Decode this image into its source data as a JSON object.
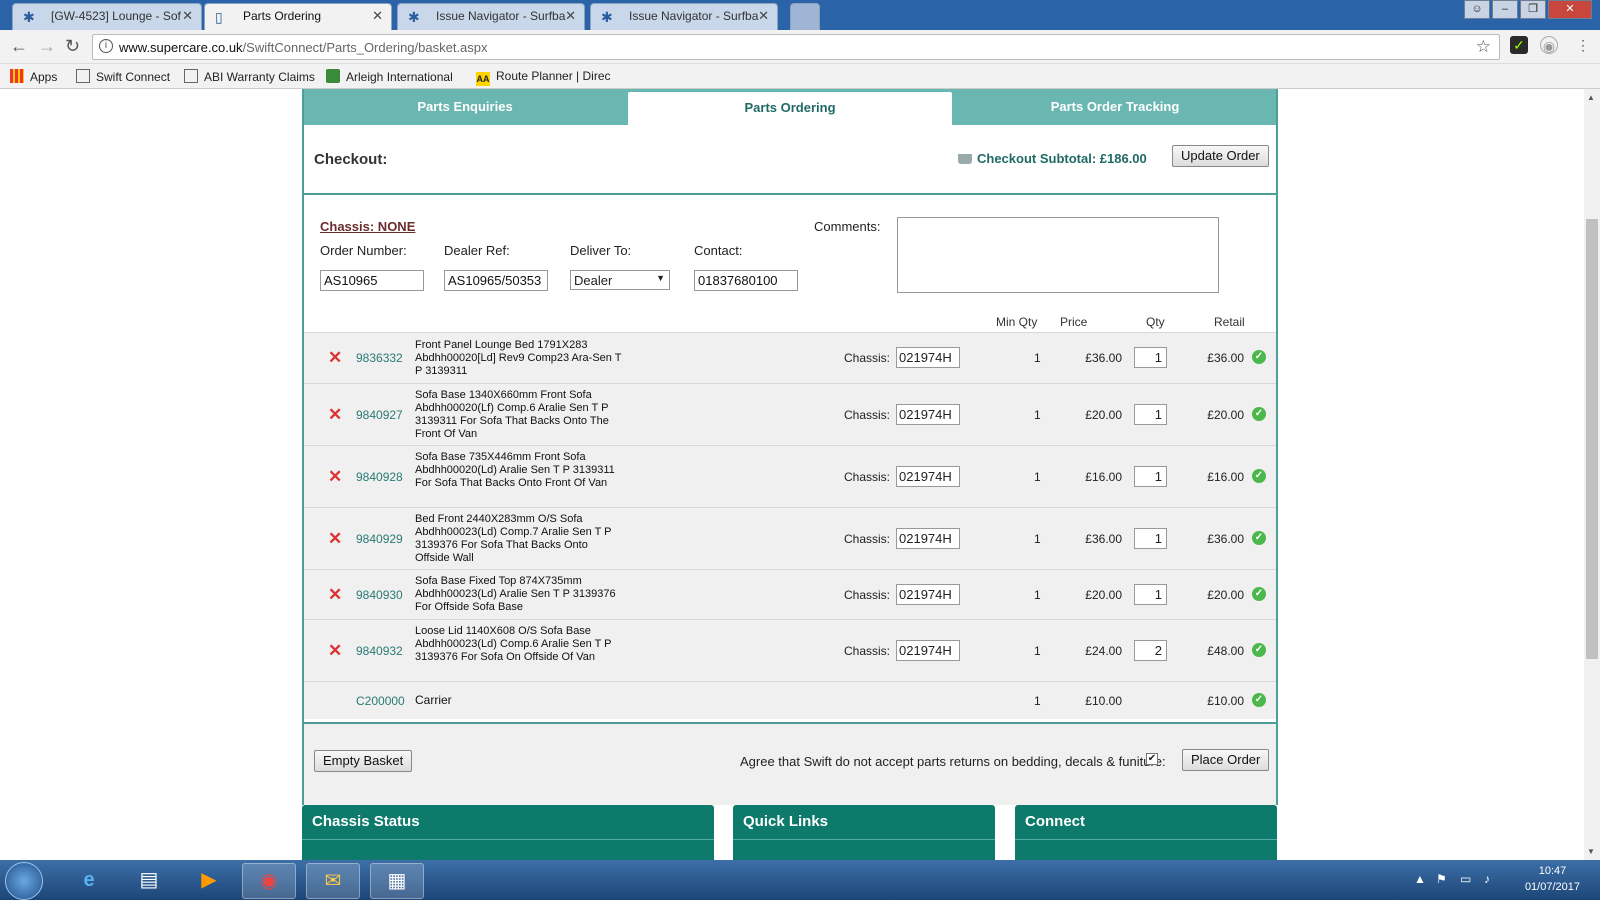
{
  "browser": {
    "tabs": [
      {
        "title": "[GW-4523] Lounge - Sof",
        "icon": "bug-icon"
      },
      {
        "title": "Parts Ordering",
        "icon": "page-icon"
      },
      {
        "title": "Issue Navigator - Surfba",
        "icon": "bug-icon"
      },
      {
        "title": "Issue Navigator - Surfba",
        "icon": "bug-icon"
      }
    ],
    "url_host": "www.supercare.co.uk",
    "url_path": "/SwiftConnect/Parts_Ordering/basket.aspx",
    "bookmarks": [
      {
        "label": "Apps",
        "icon": "apps-grid-icon"
      },
      {
        "label": "Swift Connect",
        "icon": "page-icon"
      },
      {
        "label": "ABI Warranty Claims",
        "icon": "page-icon"
      },
      {
        "label": "Arleigh International",
        "icon": "globe-icon"
      },
      {
        "label": "Route Planner | Direc",
        "icon": "aa-icon"
      }
    ]
  },
  "nav": {
    "tabs": [
      "Parts Enquiries",
      "Parts Ordering",
      "Parts Order Tracking"
    ],
    "active_tab": 1
  },
  "checkout": {
    "title": "Checkout:",
    "subtotal": "Checkout Subtotal: £186.00",
    "update_button": "Update Order"
  },
  "form": {
    "chassis_link": "Chassis: NONE",
    "order_number_label": "Order Number:",
    "order_number": "AS10965",
    "dealer_ref_label": "Dealer Ref:",
    "dealer_ref": "AS10965/50353",
    "deliver_to_label": "Deliver To:",
    "deliver_to": "Dealer",
    "contact_label": "Contact:",
    "contact": "01837680100",
    "comments_label": "Comments:",
    "comments": ""
  },
  "table": {
    "headers": {
      "min_qty": "Min Qty",
      "price": "Price",
      "qty": "Qty",
      "retail": "Retail"
    },
    "chassis_label": "Chassis:",
    "rows": [
      {
        "code": "9836332",
        "description": "Front Panel Lounge Bed 1791X283 Abdhh00020[Ld] Rev9 Comp23 Ara-Sen T P 3139311",
        "chassis": "021974H",
        "min_qty": "1",
        "price": "£36.00",
        "qty": "1",
        "retail": "£36.00"
      },
      {
        "code": "9840927",
        "description": "Sofa Base 1340X660mm Front Sofa Abdhh00020(Lf) Comp.6 Aralie Sen T P 3139311 For Sofa That Backs Onto The Front Of Van",
        "chassis": "021974H",
        "min_qty": "1",
        "price": "£20.00",
        "qty": "1",
        "retail": "£20.00"
      },
      {
        "code": "9840928",
        "description": "Sofa Base 735X446mm Front Sofa Abdhh00020(Ld) Aralie Sen T P 3139311 For Sofa That Backs Onto Front Of Van",
        "chassis": "021974H",
        "min_qty": "1",
        "price": "£16.00",
        "qty": "1",
        "retail": "£16.00"
      },
      {
        "code": "9840929",
        "description": "Bed Front 2440X283mm O/S Sofa Abdhh00023(Ld) Comp.7 Aralie Sen T P 3139376 For Sofa That Backs Onto Offside Wall",
        "chassis": "021974H",
        "min_qty": "1",
        "price": "£36.00",
        "qty": "1",
        "retail": "£36.00"
      },
      {
        "code": "9840930",
        "description": "Sofa Base Fixed Top 874X735mm Abdhh00023(Ld) Aralie Sen T P 3139376 For Offside Sofa Base",
        "chassis": "021974H",
        "min_qty": "1",
        "price": "£20.00",
        "qty": "1",
        "retail": "£20.00"
      },
      {
        "code": "9840932",
        "description": "Loose Lid 1140X608 O/S Sofa Base Abdhh00023(Ld) Comp.6 Aralie Sen T P 3139376 For Sofa On Offside Of Van",
        "chassis": "021974H",
        "min_qty": "1",
        "price": "£24.00",
        "qty": "2",
        "retail": "£48.00"
      }
    ],
    "carrier": {
      "code": "C200000",
      "description": "Carrier",
      "min_qty": "1",
      "price": "£10.00",
      "retail": "£10.00"
    }
  },
  "footer": {
    "empty_button": "Empty Basket",
    "agree_text": "Agree that Swift do not accept parts returns on bedding, decals & funiture:",
    "agree_checked": true,
    "place_button": "Place Order"
  },
  "boxes": [
    "Chassis Status",
    "Quick Links",
    "Connect"
  ],
  "taskbar": {
    "time": "10:47",
    "date": "01/07/2017"
  },
  "colors": {
    "teal": "#6ab7b1",
    "dark_teal": "#0e7a6c",
    "link_green": "#2a7a74",
    "delete_red": "#d33"
  }
}
